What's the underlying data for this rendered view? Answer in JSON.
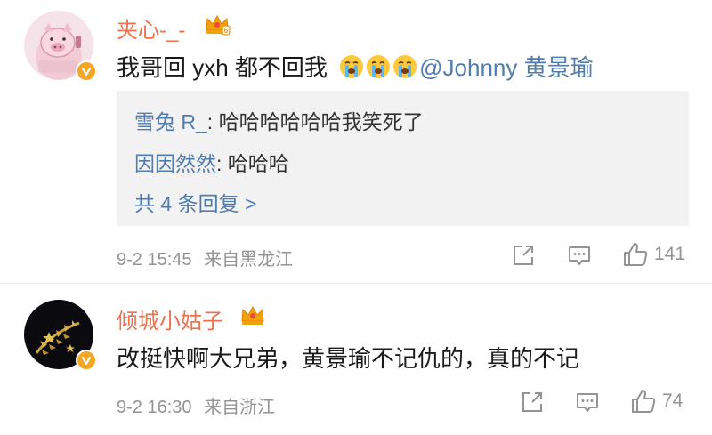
{
  "comments": [
    {
      "username": "夹心-_-",
      "text": "我哥回 yxh 都不回我",
      "emojis": [
        "crying-face",
        "crying-face",
        "crying-face"
      ],
      "mention": "@Johnny 黄景瑜",
      "replies": [
        {
          "name": "雪兔 R_",
          "text": ": 哈哈哈哈哈哈我笑死了"
        },
        {
          "name": "因因然然",
          "text": ": 哈哈哈"
        }
      ],
      "more_replies": "共 4 条回复 >",
      "time": "9-2 15:45",
      "source": "来自黑龙江",
      "likes": "141"
    },
    {
      "username": "倾城小姑子",
      "text": "改挺快啊大兄弟，黄景瑜不记仇的，真的不记",
      "time": "9-2 16:30",
      "source": "来自浙江",
      "likes": "74"
    }
  ],
  "colors": {
    "username": "#eb7350",
    "link": "#507daf",
    "meta": "#939393",
    "reply_bg": "#f2f2f2"
  }
}
